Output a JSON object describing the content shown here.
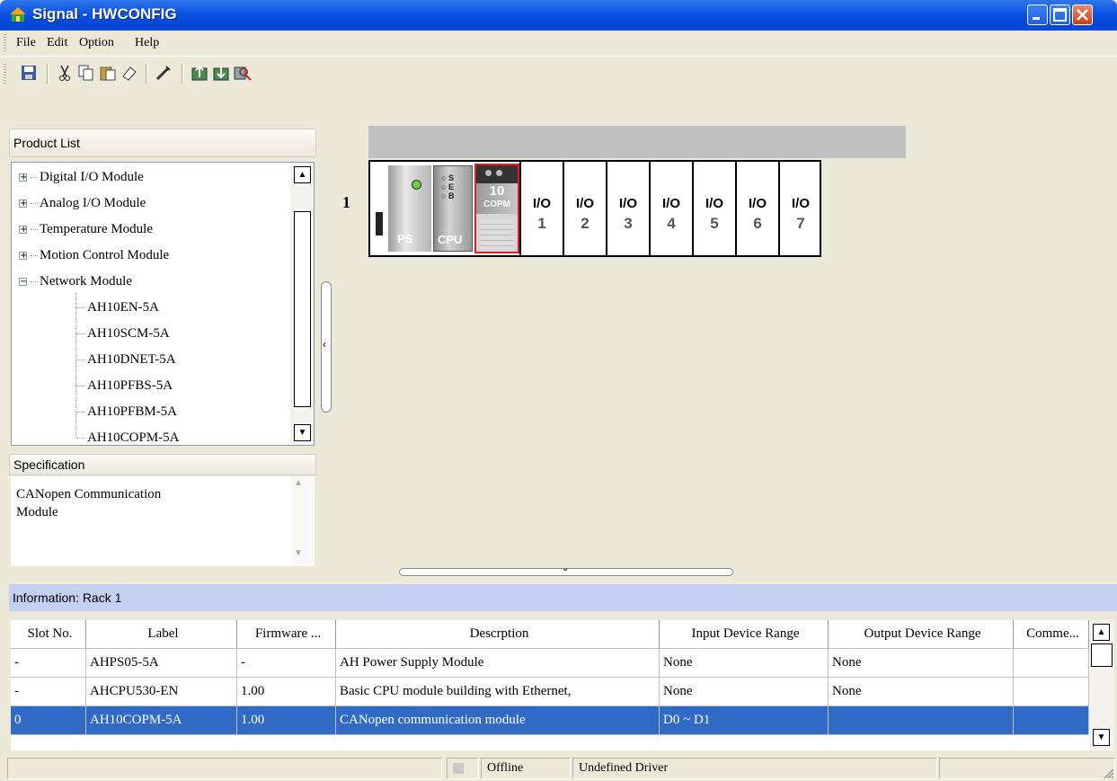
{
  "window": {
    "title": "Signal - HWCONFIG"
  },
  "menu": [
    "File",
    "Edit",
    "Option",
    "Help"
  ],
  "toolbar": [
    "save-icon",
    "cut-icon",
    "copy-icon",
    "paste-icon",
    "erase-icon",
    "wand-icon",
    "upload-icon",
    "download-icon",
    "scan-icon"
  ],
  "product_list": {
    "header": "Product List",
    "items": [
      {
        "label": "Digital I/O Module",
        "expander": "+"
      },
      {
        "label": "Analog I/O Module",
        "expander": "+"
      },
      {
        "label": "Temperature Module",
        "expander": "+"
      },
      {
        "label": "Motion Control Module",
        "expander": "+"
      },
      {
        "label": "Network Module",
        "expander": "−"
      },
      {
        "label": "AH10EN-5A"
      },
      {
        "label": "AH10SCM-5A"
      },
      {
        "label": "AH10DNET-5A"
      },
      {
        "label": "AH10PFBS-5A"
      },
      {
        "label": "AH10PFBM-5A"
      },
      {
        "label": "AH10COPM-5A"
      }
    ]
  },
  "specification": {
    "header": "Specification",
    "text1": "CANopen Communication",
    "text2": "Module"
  },
  "rack": {
    "number": "1",
    "ps_label": "PS",
    "cpu_label": "CPU",
    "cpu_leds": [
      "S",
      "E",
      "B"
    ],
    "copm_num": "10",
    "copm_label": "COPM",
    "io_label": "I/O",
    "slots": [
      "1",
      "2",
      "3",
      "4",
      "5",
      "6",
      "7"
    ]
  },
  "info": {
    "header": "Information: Rack 1"
  },
  "table": {
    "columns": [
      "Slot No.",
      "Label",
      "Firmware ...",
      "Descrption",
      "Input Device Range",
      "Output Device Range",
      "Comme..."
    ],
    "rows": [
      [
        "-",
        "AHPS05-5A",
        "-",
        "AH Power Supply Module",
        "None",
        "None",
        ""
      ],
      [
        "-",
        "AHCPU530-EN",
        "1.00",
        "Basic CPU module building with Ethernet,",
        "None",
        "None",
        ""
      ],
      [
        "0",
        "AH10COPM-5A",
        "1.00",
        "CANopen communication module",
        "D0 ~ D1",
        "",
        ""
      ]
    ]
  },
  "status": {
    "mode": "Offline",
    "driver": "Undefined Driver"
  },
  "colors": {
    "title_bar": "#0a53df",
    "selection": "#316ac5",
    "info_header": "#c5cff2"
  }
}
